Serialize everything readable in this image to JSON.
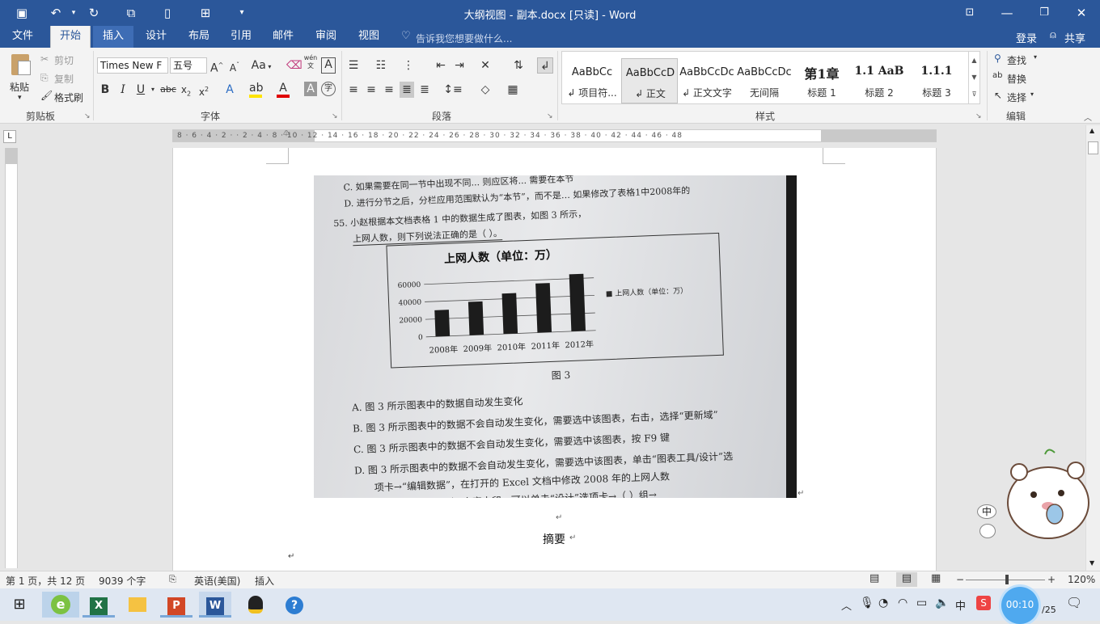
{
  "window": {
    "title": "大纲视图 - 副本.docx [只读] - Word"
  },
  "tabs": [
    "文件",
    "开始",
    "插入",
    "设计",
    "布局",
    "引用",
    "邮件",
    "审阅",
    "视图"
  ],
  "tell_me": "告诉我您想要做什么...",
  "account": {
    "login": "登录",
    "share": "共享"
  },
  "clipboard": {
    "paste": "粘贴",
    "cut": "剪切",
    "copy": "复制",
    "format_painter": "格式刷",
    "label": "剪贴板"
  },
  "font": {
    "name": "Times New F",
    "size": "五号",
    "label": "字体",
    "case_btn": "Aa",
    "pinyin": "wén"
  },
  "paragraph": {
    "label": "段落"
  },
  "styles": {
    "label": "样式",
    "items": [
      {
        "preview": "AaBbCc",
        "name": "↲ 项目符..."
      },
      {
        "preview": "AaBbCcD",
        "name": "↲ 正文"
      },
      {
        "preview": "AaBbCcDc",
        "name": "↲ 正文文字"
      },
      {
        "preview": "AaBbCcDc",
        "name": "无间隔"
      },
      {
        "preview": "第1章",
        "name": "标题 1"
      },
      {
        "preview": "1.1 AaB",
        "name": "标题 2"
      },
      {
        "preview": "1.1.1",
        "name": "标题 3"
      }
    ]
  },
  "editing": {
    "find": "查找",
    "replace": "替换",
    "select": "选择",
    "label": "编辑"
  },
  "ruler_ticks": "8 · 6 · 4 · 2 · · 2 · 4 · 8 · 10 · 12 · 14 · 16 · 18 · 20 · 22 · 24 · 26 · 28 · 30 · 32 · 34 · 36 · 38 · 40 · 42 · 44 · 46 · 48",
  "photo": {
    "line1": "C. 如果需要在同一节中出现不同... 则应区将... 需要在本节",
    "line2": "D. 进行分节之后，分栏应用范围默认为“本节”，而不是… 如果修改了表格1中2008年的",
    "q55": "55.  小赵根据本文档表格 1 中的数据生成了图表，如图 3 所示，",
    "q55b": "上网人数，则下列说法正确的是（      ）。",
    "chart_title": "上网人数（单位：万）",
    "legend": "■ 上网人数（单位：万）",
    "fig": "图 3",
    "optA": "A.  图 3 所示图表中的数据自动发生变化",
    "optB": "B.  图 3 所示图表中的数据不会自动发生变化，需要选中该图表，右击，选择“更新域”",
    "optC": "C.  图 3 所示图表中的数据不会自动发生变化，需要选中该图表，按 F9 键",
    "optC2": "C.  图 3 所示图表中的数据不会自动发生变化，需要选中该图表，单击“图表工具/设计”选",
    "optD": "D.  图 3 所示图表中的数据不会自动发生变化，需要选中该图表，单击“图表工具/设计”选",
    "optD2": "项卡→“编辑数据”，在打开的 Excel 文档中修改 2008 年的上网人数",
    "next": "……设置“国民普查”文字水印，可以单击“设计”选项卡→（     ）组→"
  },
  "chart_data": {
    "type": "bar",
    "title": "上网人数（单位：万）",
    "categories": [
      "2008年",
      "2009年",
      "2010年",
      "2011年",
      "2012年"
    ],
    "series": [
      {
        "name": "上网人数（单位：万）",
        "values": [
          30000,
          38000,
          46000,
          56000,
          65000
        ]
      }
    ],
    "yticks": [
      "0",
      "20000",
      "40000",
      "60000"
    ],
    "ylim": [
      0,
      70000
    ],
    "legend": "right",
    "grid": true
  },
  "doc": {
    "heading": "摘要",
    "para_mark": "↵"
  },
  "status": {
    "page": "第 1 页，共 12 页",
    "words": "9039 个字",
    "lang": "英语(美国)",
    "mode": "插入",
    "zoom": "120%"
  },
  "taskbar": {
    "timer": "00:10",
    "date": "/25",
    "ime": "中"
  },
  "colors": {
    "brand": "#2b579a",
    "ribbon": "#f3f3f3"
  }
}
